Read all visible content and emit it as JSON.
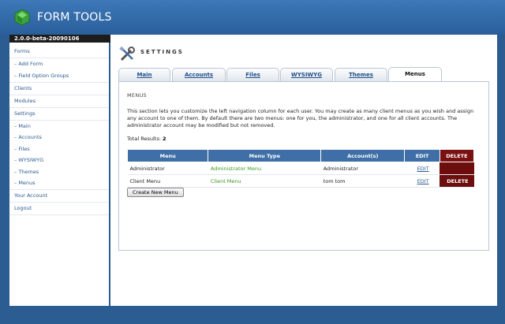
{
  "app": {
    "title": "FORM TOOLS",
    "version": "2.0.0-beta-20090106"
  },
  "sidebar": {
    "items": [
      {
        "label": "Forms"
      },
      {
        "label": "– Add Form"
      },
      {
        "label": "– Field Option Groups"
      },
      {
        "label": "Clients"
      },
      {
        "label": "Modules"
      },
      {
        "label": "Settings"
      },
      {
        "label": "– Main"
      },
      {
        "label": "– Accounts"
      },
      {
        "label": "– Files"
      },
      {
        "label": "– WYSIWYG"
      },
      {
        "label": "– Themes"
      },
      {
        "label": "– Menus"
      },
      {
        "label": "Your Account"
      },
      {
        "label": "Logout"
      }
    ]
  },
  "page": {
    "title": "SETTINGS"
  },
  "tabs": [
    {
      "label": "Main"
    },
    {
      "label": "Accounts"
    },
    {
      "label": "Files"
    },
    {
      "label": "WYSIWYG"
    },
    {
      "label": "Themes"
    },
    {
      "label": "Menus"
    }
  ],
  "panel": {
    "section_label": "MENUS",
    "description": "This section lets you customize the left navigation column for each user. You may create as many client menus as you wish and assign any account to one of them. By default there are two menus: one for you, the administrator, and one for all client accounts. The administrator account may be modified but not removed.",
    "total_label": "Total Results:",
    "total_value": "2",
    "table": {
      "headers": [
        "Menu",
        "Menu Type",
        "Account(s)",
        "EDIT",
        "DELETE"
      ],
      "rows": [
        {
          "menu": "Administrator",
          "type": "Administrator Menu",
          "accounts": "Administrator",
          "edit": "EDIT",
          "delete": ""
        },
        {
          "menu": "Client Menu",
          "type": "Client Menu",
          "accounts": "tom tom",
          "edit": "EDIT",
          "delete": "DELETE"
        }
      ]
    },
    "create_button": "Create New Menu"
  },
  "colors": {
    "header_blue": "#2a5f9b",
    "table_header": "#3f6fa6",
    "delete_red": "#6d0e0e",
    "menu_type_green": "#3a9a22"
  }
}
